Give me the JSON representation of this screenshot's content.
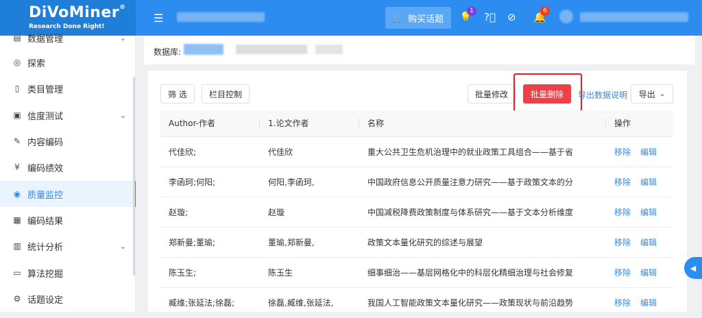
{
  "brand": {
    "name": "DiVoMiner",
    "reg": "®",
    "tagline": "Research Done Right!"
  },
  "header": {
    "menu_icon": "menu-fold-icon",
    "buy_button": {
      "label": "购买话题",
      "icon": "cart-icon"
    },
    "notifications": {
      "tips_count": "1",
      "bell_count": "6"
    }
  },
  "sidebar": {
    "items": [
      {
        "label": "数据管理",
        "icon": "database-icon",
        "has_chevron": true
      },
      {
        "label": "探索",
        "icon": "compass-icon"
      },
      {
        "label": "类目管理",
        "icon": "file-icon"
      },
      {
        "label": "信度测试",
        "icon": "clipboard-icon",
        "has_chevron": true
      },
      {
        "label": "内容编码",
        "icon": "pen-icon"
      },
      {
        "label": "编码绩效",
        "icon": "yen-icon"
      },
      {
        "label": "质量监控",
        "icon": "eye-icon",
        "active": true
      },
      {
        "label": "编码结果",
        "icon": "list-icon"
      },
      {
        "label": "统计分析",
        "icon": "bar-chart-icon",
        "has_chevron": true
      },
      {
        "label": "算法挖掘",
        "icon": "monitor-icon"
      },
      {
        "label": "话题设定",
        "icon": "gear-icon"
      }
    ]
  },
  "dbbar": {
    "label": "数据库:"
  },
  "toolbar": {
    "filter": "筛 选",
    "columns": "栏目控制",
    "batch_edit": "批量修改",
    "batch_delete": "批量删除",
    "export_help": "导出数据说明",
    "export": "导出"
  },
  "table": {
    "columns": [
      "Author-作者",
      "1.论文作者",
      "名称",
      "操作"
    ],
    "actions": {
      "remove": "移除",
      "edit": "编辑"
    },
    "rows": [
      [
        "代佳欣;",
        "代佳欣",
        "重大公共卫生危机治理中的就业政策工具组合——基于省"
      ],
      [
        "李函珂;何阳;",
        "何阳,李函珂,",
        "中国政府信息公开质量注意力研究——基于政策文本的分"
      ],
      [
        "赵璇;",
        "赵璇",
        "中国减税降费政策制度与体系研究——基于文本分析维度"
      ],
      [
        "郑新曼;董瑜;",
        "董瑜,郑新曼,",
        "政策文本量化研究的综述与展望"
      ],
      [
        "陈玉生;",
        "陈玉生",
        "细事细治——基层网格化中的科层化精细治理与社会修复"
      ],
      [
        "臧维;张延法;徐磊;",
        "徐磊,臧维,张延法,",
        "我国人工智能政策文本量化研究——政策现状与前沿趋势"
      ]
    ]
  },
  "colors": {
    "primary": "#2d8cf0",
    "danger": "#ed4048",
    "highlight": "#e0201f"
  }
}
